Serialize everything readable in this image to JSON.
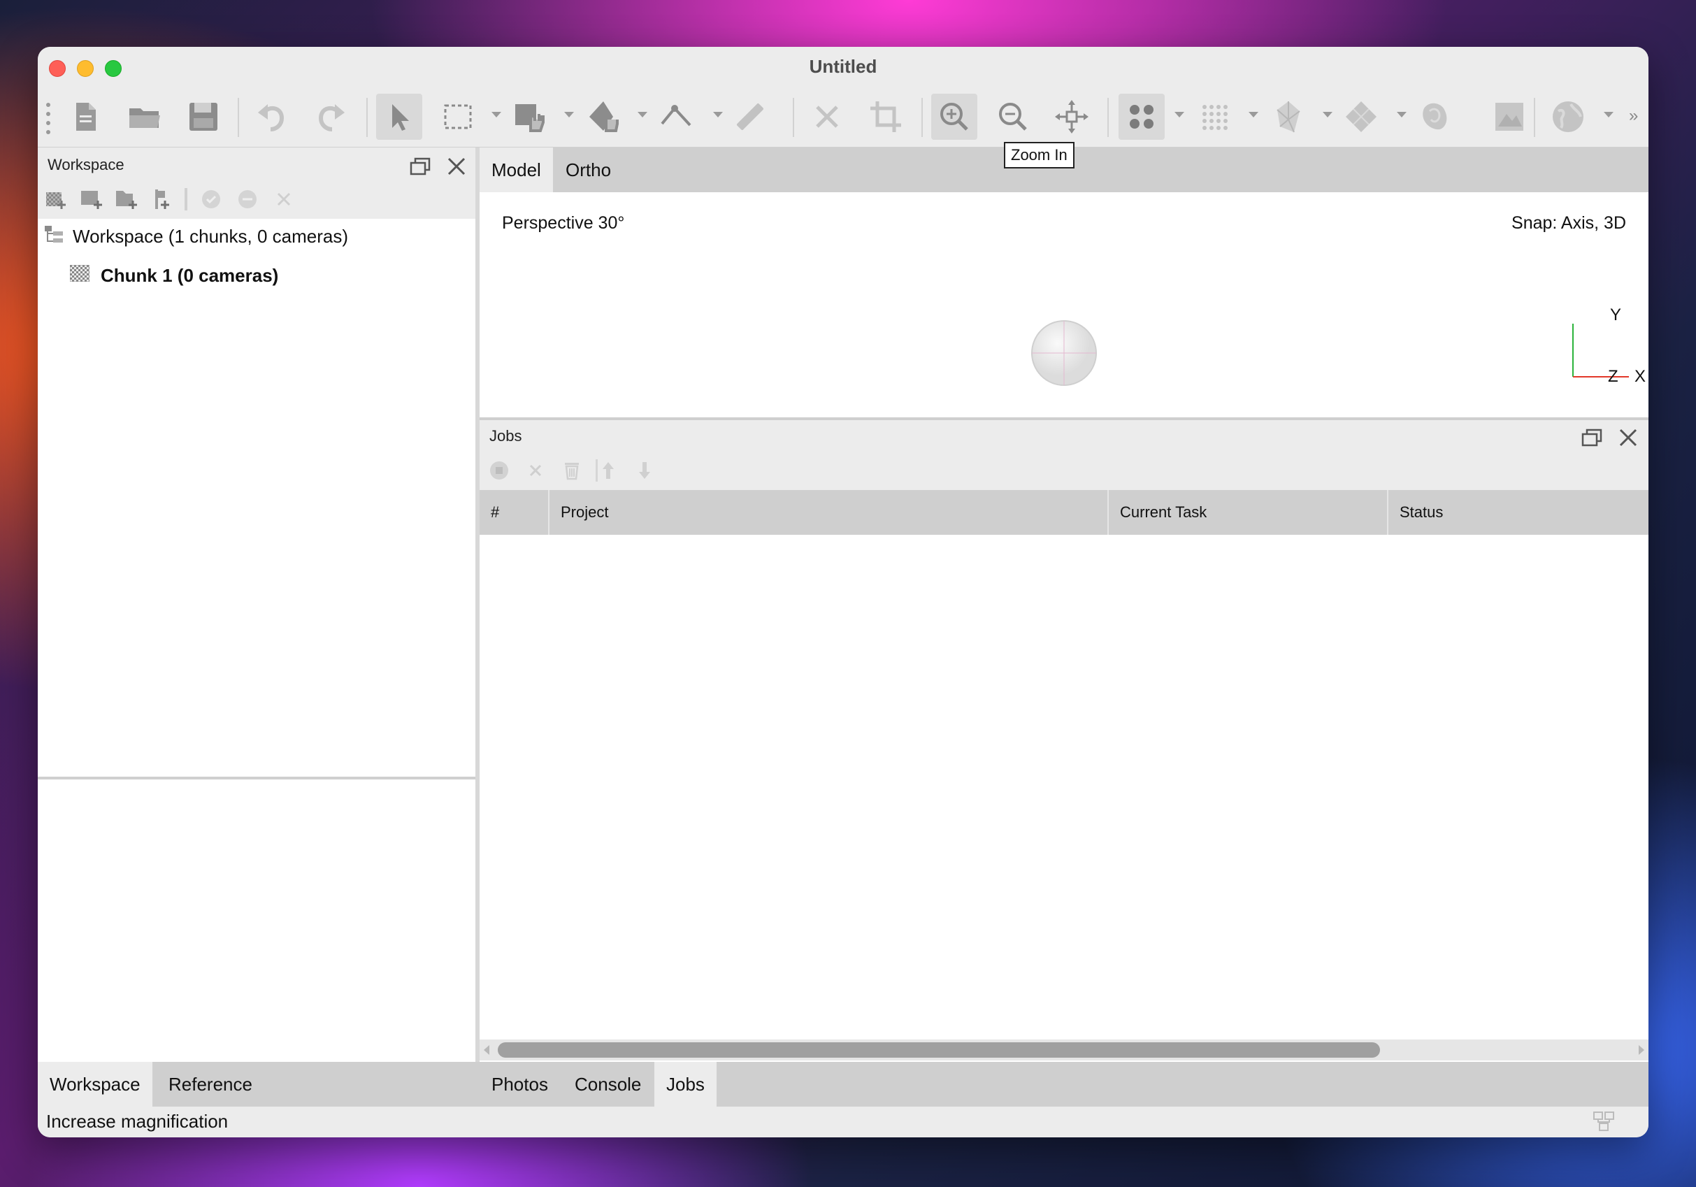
{
  "window": {
    "title": "Untitled"
  },
  "toolbar": {
    "tooltip": "Zoom In",
    "icons": [
      "new-document-icon",
      "open-folder-icon",
      "save-icon",
      "undo-icon",
      "redo-icon",
      "select-pointer-icon",
      "rectangle-selection-icon",
      "hand-tool-icon",
      "shape-draw-icon",
      "ruler-line-icon",
      "measure-icon",
      "delete-icon",
      "crop-icon",
      "zoom-in-icon",
      "zoom-out-icon",
      "move-object-icon",
      "point-cloud-icon",
      "dense-cloud-icon",
      "mesh-icon",
      "tiled-model-icon",
      "dem-icon",
      "orthomosaic-icon",
      "globe-icon",
      "overflow-icon"
    ]
  },
  "workspace_panel": {
    "title": "Workspace",
    "tree": {
      "root": "Workspace (1 chunks, 0 cameras)",
      "chunk": "Chunk 1 (0 cameras)"
    }
  },
  "view": {
    "tabs": [
      "Model",
      "Ortho"
    ],
    "selected_tab": "Model",
    "projection": "Perspective 30°",
    "snap": "Snap: Axis, 3D",
    "axes": {
      "y": "Y",
      "z": "Z",
      "x": "X"
    }
  },
  "jobs_panel": {
    "title": "Jobs",
    "columns": [
      "#",
      "Project",
      "Current Task",
      "Status"
    ]
  },
  "left_bottom_tabs": [
    "Workspace",
    "Reference"
  ],
  "right_bottom_tabs": [
    "Photos",
    "Console",
    "Jobs"
  ],
  "status_bar": {
    "text": "Increase magnification"
  }
}
